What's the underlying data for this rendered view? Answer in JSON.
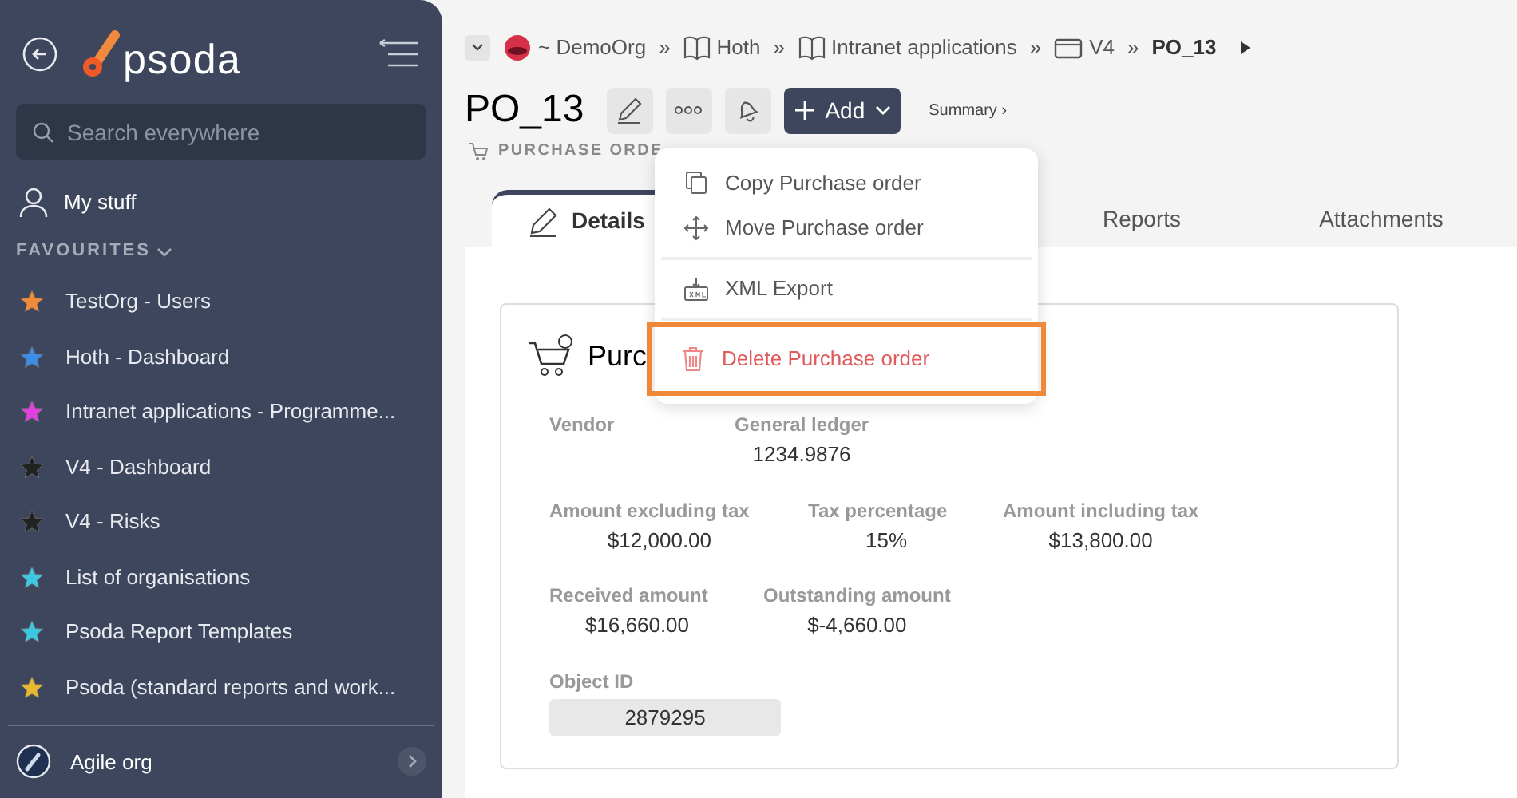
{
  "sidebar": {
    "logo": "psoda",
    "search": {
      "placeholder": "Search everywhere"
    },
    "my_stuff": "My stuff",
    "favourites_heading": "FAVOURITES",
    "favourites": [
      {
        "label": "TestOrg - Users",
        "color": "#f08a3c"
      },
      {
        "label": "Hoth - Dashboard",
        "color": "#3a8ee6"
      },
      {
        "label": "Intranet applications - Programme...",
        "color": "#e040e0"
      },
      {
        "label": "V4 - Dashboard",
        "color": "#222222"
      },
      {
        "label": "V4 - Risks",
        "color": "#222222"
      },
      {
        "label": "List of organisations",
        "color": "#3cc8e0"
      },
      {
        "label": "Psoda Report Templates",
        "color": "#3cc8e0"
      },
      {
        "label": "Psoda (standard reports and work...",
        "color": "#e8b830"
      }
    ],
    "org": "Agile org"
  },
  "breadcrumb_separator": "»",
  "breadcrumb": [
    {
      "label": "~ DemoOrg",
      "kind": "org"
    },
    {
      "label": "Hoth",
      "kind": "book"
    },
    {
      "label": "Intranet applications",
      "kind": "book"
    },
    {
      "label": "V4",
      "kind": "folder"
    },
    {
      "label": "PO_13",
      "kind": "current"
    }
  ],
  "title": "PO_13",
  "add_button": "Add",
  "summary_link": "Summary ›",
  "type_label": "PURCHASE ORDE",
  "tabs": [
    {
      "label": "Details",
      "selected": true
    },
    {
      "label": "Reports",
      "selected": false
    },
    {
      "label": "Attachments",
      "selected": false
    }
  ],
  "card_title": "Purc",
  "field_rows": [
    [
      {
        "label": "Vendor"
      },
      {
        "label": "General ledger",
        "value": "1234.9876"
      }
    ],
    [
      {
        "label": "Amount excluding tax",
        "value": "$12,000.00"
      },
      {
        "label": "Tax percentage",
        "value": "15%"
      },
      {
        "label": "Amount including tax",
        "value": "$13,800.00"
      }
    ],
    [
      {
        "label": "Received amount",
        "value": "$16,660.00"
      },
      {
        "label": "Outstanding amount",
        "value": "$-4,660.00"
      }
    ],
    [
      {
        "label": "Object ID",
        "value": "2879295",
        "kind": "readonly"
      }
    ]
  ],
  "menu": [
    {
      "label": "Copy Purchase order",
      "kind": "copy",
      "highlighted": false
    },
    {
      "label": "Move Purchase order",
      "kind": "move",
      "highlighted": false
    },
    {
      "label": "XML Export",
      "kind": "xml",
      "highlighted": false
    },
    {
      "label": "Delete Purchase order",
      "kind": "delete",
      "highlighted": true
    }
  ]
}
